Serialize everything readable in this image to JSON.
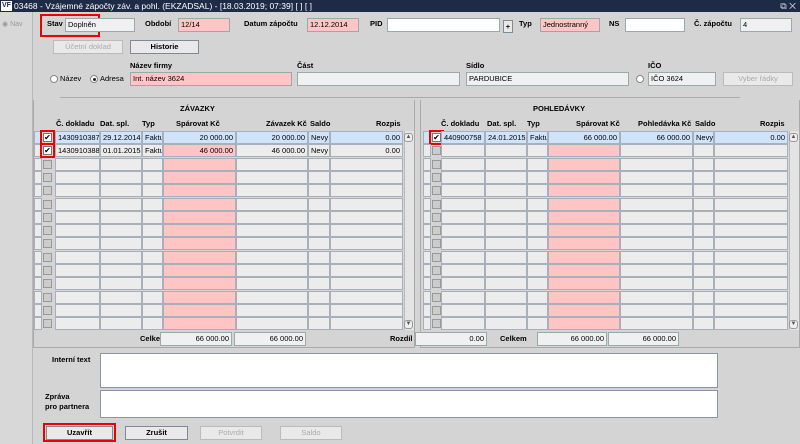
{
  "window": {
    "title": "03468 - Vzájemné zápočty záv. a pohl. (EKZADSAL) - [18.03.2019; 07:39] [ ] [ ]",
    "logo": "VF",
    "nav_label": "Nav",
    "restore_icon": "restore-icon",
    "close_icon": "close-icon"
  },
  "header": {
    "stav_label": "Stav",
    "stav_value": "Doplněn",
    "obdobi_label": "Období",
    "obdobi_value": "12/14",
    "datum_label": "Datum zápočtu",
    "datum_value": "12.12.2014",
    "pid_label": "PID",
    "pid_value": "",
    "pid_plus": "+",
    "typ_label": "Typ",
    "typ_value": "Jednostranný",
    "ns_label": "NS",
    "ns_value": "",
    "cislo_label": "Č. zápočtu",
    "cislo_value": "4",
    "ucetni_doklad": "Účetní doklad",
    "historie": "Historie",
    "radio_nazev": "Název",
    "radio_adresa": "Adresa",
    "radio_selected": "Adresa",
    "nazev_firmy_label": "Název firmy",
    "nazev_firmy_value": "Int. název 3624",
    "cast_label": "Část",
    "cast_value": "",
    "sidlo_label": "Sídlo",
    "sidlo_value": "PARDUBICE",
    "ico_label": "IČO",
    "ico_value": "IČO 3624",
    "vyber_radky": "Vyber řádky"
  },
  "zavazky": {
    "title": "ZÁVAZKY",
    "columns": [
      "Č. dokladu",
      "Dat. spl.",
      "Typ",
      "Spárovat Kč",
      "Závazek Kč",
      "Saldo",
      "Rozpis"
    ],
    "rows": [
      {
        "checked": true,
        "doklad": "1430910387",
        "dat": "29.12.2014",
        "typ": "Faktu",
        "sparovat": "20 000.00",
        "castka": "20 000.00",
        "saldo": "Nevy",
        "rozpis": "0.00"
      },
      {
        "checked": true,
        "doklad": "1430910388",
        "dat": "01.01.2015",
        "typ": "Faktu",
        "sparovat": "46 000.00",
        "castka": "46 000.00",
        "saldo": "Nevy",
        "rozpis": "0.00"
      }
    ],
    "celkem_label": "Celkem",
    "celkem_sparovat": "66 000.00",
    "celkem_castka": "66 000.00"
  },
  "pohledavky": {
    "title": "POHLEDÁVKY",
    "columns": [
      "Č. dokladu",
      "Dat. spl.",
      "Typ",
      "Spárovat Kč",
      "Pohledávka Kč",
      "Saldo",
      "Rozpis"
    ],
    "rows": [
      {
        "checked": true,
        "doklad": "440900758",
        "dat": "24.01.2015",
        "typ": "Faktu",
        "sparovat": "66 000.00",
        "castka": "66 000.00",
        "saldo": "Nevy",
        "rozpis": "0.00"
      }
    ],
    "celkem_label": "Celkem",
    "celkem_sparovat": "66 000.00",
    "celkem_castka": "66 000.00"
  },
  "rozdil_label": "Rozdíl",
  "rozdil_value": "0.00",
  "interni_text_label": "Interní text",
  "interni_text_value": "",
  "zprava_label_1": "Zpráva",
  "zprava_label_2": "pro partnera",
  "zprava_value": "",
  "buttons": {
    "uzavrit": "Uzavřít",
    "zrusit": "Zrušit",
    "potvrdit": "Potvrdit",
    "saldo": "Saldo"
  },
  "highlight_color": "#ee0000"
}
